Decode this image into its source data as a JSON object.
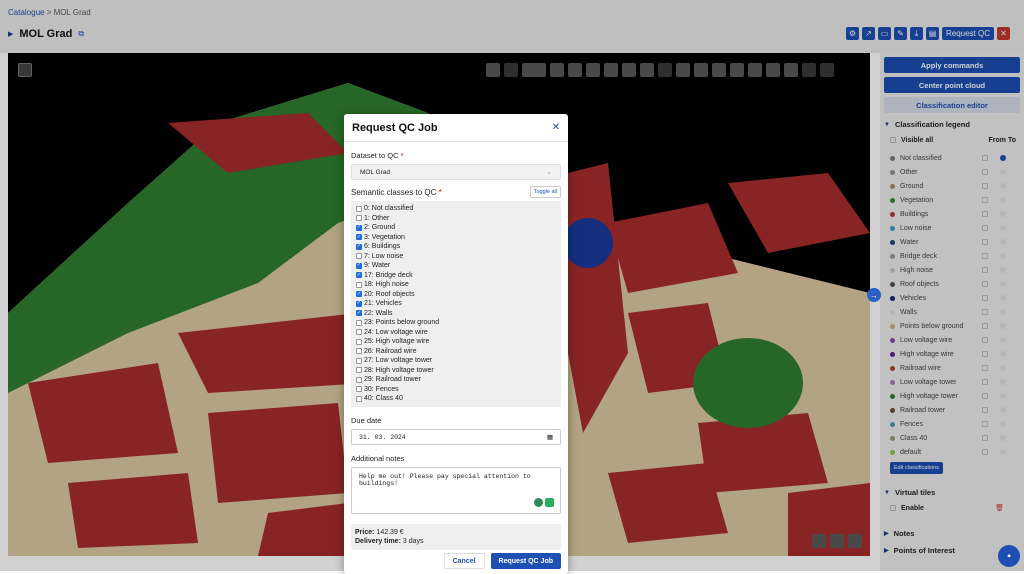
{
  "breadcrumb": {
    "parent": "Catalogue",
    "sep": " > ",
    "current": "MOL Grad"
  },
  "header": {
    "title": "MOL Grad",
    "request_qc_label": "Request QC"
  },
  "right_panel": {
    "apply_commands": "Apply commands",
    "center_point_cloud": "Center point cloud",
    "classification_editor": "Classification editor",
    "legend_title": "Classification legend",
    "visible_all": "Visible all",
    "from_to": "From To",
    "items": [
      {
        "label": "Not classified",
        "color": "#7a7a7a"
      },
      {
        "label": "Other",
        "color": "#8f8f8f"
      },
      {
        "label": "Ground",
        "color": "#a88a5a"
      },
      {
        "label": "Vegetation",
        "color": "#2e8b3a"
      },
      {
        "label": "Buildings",
        "color": "#b03a3a"
      },
      {
        "label": "Low noise",
        "color": "#3a9bd0"
      },
      {
        "label": "Water",
        "color": "#1e3a8a"
      },
      {
        "label": "Bridge deck",
        "color": "#9a9a9a"
      },
      {
        "label": "High noise",
        "color": "#c8c8c8"
      },
      {
        "label": "Roof objects",
        "color": "#555555"
      },
      {
        "label": "Vehicles",
        "color": "#1a237e"
      },
      {
        "label": "Walls",
        "color": "#dcdcdc"
      },
      {
        "label": "Points below ground",
        "color": "#c9b26b"
      },
      {
        "label": "Low voltage wire",
        "color": "#8e44ad"
      },
      {
        "label": "High voltage wire",
        "color": "#6a1b9a"
      },
      {
        "label": "Railroad wire",
        "color": "#c0392b"
      },
      {
        "label": "Low voltage tower",
        "color": "#9e7cc1"
      },
      {
        "label": "High voltage tower",
        "color": "#2e7d32"
      },
      {
        "label": "Railroad tower",
        "color": "#6d4c41"
      },
      {
        "label": "Fences",
        "color": "#3aa0a0"
      },
      {
        "label": "Class 40",
        "color": "#9aa06a"
      },
      {
        "label": "default",
        "color": "#8bc34a"
      }
    ],
    "edit_classifications": "Edit classifications",
    "virtual_tiles": "Virtual tiles",
    "enable": "Enable",
    "notes": "Notes",
    "points_of_interest": "Points of Interest"
  },
  "dialog": {
    "title": "Request QC Job",
    "dataset_label": "Dataset to QC",
    "dataset_value": "MOL Grad",
    "classes_label": "Semantic classes to QC",
    "toggle_all": "Toggle all",
    "classes": [
      {
        "label": "0: Not classified",
        "checked": false
      },
      {
        "label": "1: Other",
        "checked": false
      },
      {
        "label": "2: Ground",
        "checked": true
      },
      {
        "label": "3: Vegetation",
        "checked": true
      },
      {
        "label": "6: Buildings",
        "checked": true
      },
      {
        "label": "7: Low noise",
        "checked": false
      },
      {
        "label": "9: Water",
        "checked": true
      },
      {
        "label": "17: Bridge deck",
        "checked": true
      },
      {
        "label": "18: High noise",
        "checked": false
      },
      {
        "label": "20: Roof objects",
        "checked": true
      },
      {
        "label": "21: Vehicles",
        "checked": true
      },
      {
        "label": "22: Walls",
        "checked": true
      },
      {
        "label": "23: Points below ground",
        "checked": false
      },
      {
        "label": "24: Low voltage wire",
        "checked": false
      },
      {
        "label": "25: High voltage wire",
        "checked": false
      },
      {
        "label": "26: Railroad wire",
        "checked": false
      },
      {
        "label": "27: Low voltage tower",
        "checked": false
      },
      {
        "label": "28: High voltage tower",
        "checked": false
      },
      {
        "label": "29: Railroad tower",
        "checked": false
      },
      {
        "label": "30: Fences",
        "checked": false
      },
      {
        "label": "40: Class 40",
        "checked": false
      }
    ],
    "due_date_label": "Due date",
    "due_date_value": "31. 03. 2024",
    "notes_label": "Additional notes",
    "notes_value": "Help me out! Please pay special attention to buildings!",
    "price_label": "Price:",
    "price_value": "142.39 €",
    "delivery_label": "Delivery time:",
    "delivery_value": "3 days",
    "cancel": "Cancel",
    "submit": "Request QC Job"
  }
}
